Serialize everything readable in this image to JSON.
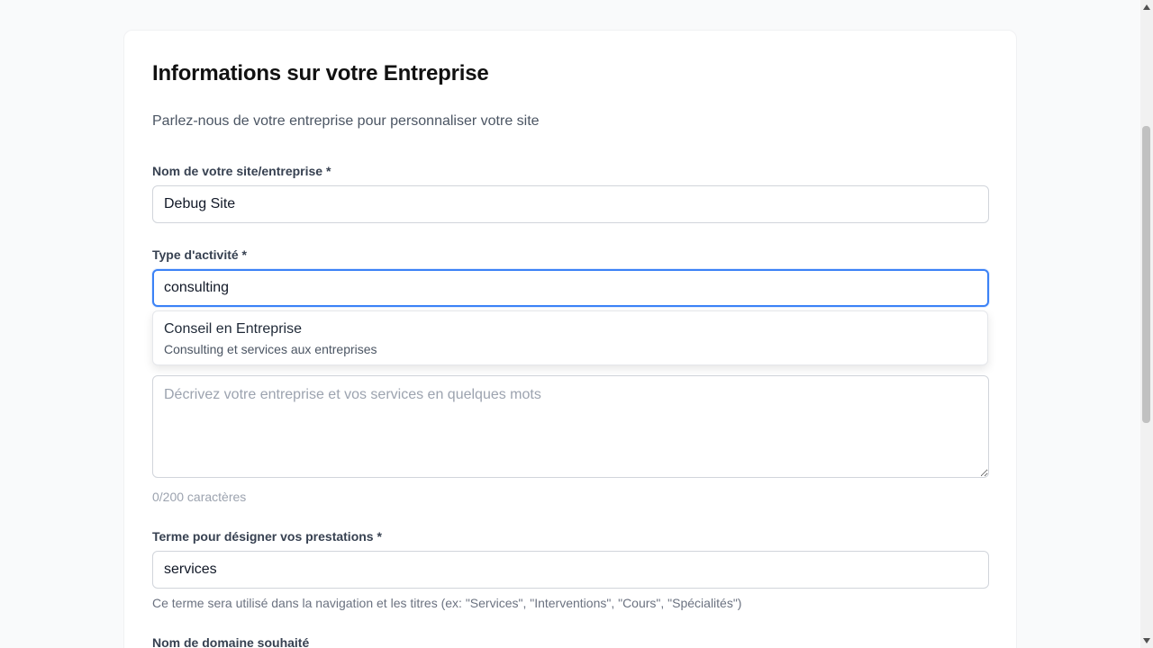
{
  "form": {
    "title": "Informations sur votre Entreprise",
    "subtitle": "Parlez-nous de votre entreprise pour personnaliser votre site",
    "site_name": {
      "label": "Nom de votre site/entreprise *",
      "value": "Debug Site"
    },
    "activity_type": {
      "label": "Type d'activité *",
      "value": "consulting",
      "suggestions": [
        {
          "title": "Conseil en Entreprise",
          "description": "Consulting et services aux entreprises"
        }
      ]
    },
    "description": {
      "placeholder": "Décrivez votre entreprise et vos services en quelques mots",
      "value": "",
      "counter": "0/200 caractères"
    },
    "service_term": {
      "label": "Terme pour désigner vos prestations *",
      "value": "services",
      "hint": "Ce terme sera utilisé dans la navigation et les titres (ex: \"Services\", \"Interventions\", \"Cours\", \"Spécialités\")"
    },
    "domain": {
      "label": "Nom de domaine souhaité"
    }
  },
  "colors": {
    "focus_border": "#3b82f6",
    "page_background": "#f9fafb",
    "card_background": "#ffffff"
  }
}
